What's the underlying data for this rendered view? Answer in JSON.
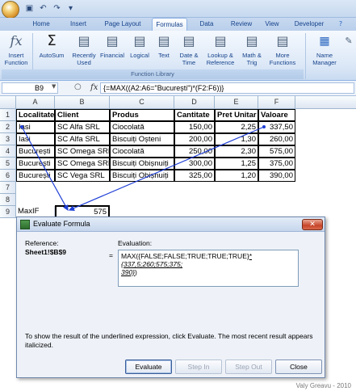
{
  "ribbon": {
    "tabs": [
      "Home",
      "Insert",
      "Page Layout",
      "Formulas",
      "Data",
      "Review",
      "View",
      "Developer"
    ],
    "active_tab": "Formulas",
    "buttons": [
      {
        "label": "Insert Function",
        "icon": "fx-icon"
      },
      {
        "label": "AutoSum",
        "icon": "sigma-icon"
      },
      {
        "label": "Recently Used",
        "icon": "book-icon"
      },
      {
        "label": "Financial",
        "icon": "book-icon"
      },
      {
        "label": "Logical",
        "icon": "book-icon"
      },
      {
        "label": "Text",
        "icon": "book-icon"
      },
      {
        "label": "Date & Time",
        "icon": "book-icon"
      },
      {
        "label": "Lookup & Reference",
        "icon": "book-icon"
      },
      {
        "label": "Math & Trig",
        "icon": "book-icon"
      },
      {
        "label": "More Functions",
        "icon": "book-icon"
      },
      {
        "label": "Name Manager",
        "icon": "name-manager-icon"
      }
    ],
    "group_label": "Function Library"
  },
  "formula_bar": {
    "name_box": "B9",
    "fx": "fx",
    "formula": "{=MAX((A2:A6=\"București\")*(F2:F6))}"
  },
  "columns": [
    "A",
    "B",
    "C",
    "D",
    "E",
    "F"
  ],
  "rows": [
    "1",
    "2",
    "3",
    "4",
    "5",
    "6",
    "7",
    "8",
    "9"
  ],
  "table": {
    "headers": [
      "Localitate",
      "Client",
      "Produs",
      "Cantitate",
      "Pret Unitar",
      "Valoare"
    ],
    "rows": [
      [
        "Iasi",
        "SC Alfa SRL",
        "Ciocolată",
        "150,00",
        "2,25",
        "337,50"
      ],
      [
        "Iasi",
        "SC Alfa SRL",
        "Biscuiți Oșteni",
        "200,00",
        "1,30",
        "260,00"
      ],
      [
        "București",
        "SC Omega SRL",
        "Ciocolată",
        "250,00",
        "2,30",
        "575,00"
      ],
      [
        "București",
        "SC Omega SRL",
        "Biscuiți Obișnuiți",
        "300,00",
        "1,25",
        "375,00"
      ],
      [
        "București",
        "SC Vega SRL",
        "Biscuiți Obișnuiți",
        "325,00",
        "1,20",
        "390,00"
      ]
    ]
  },
  "maxif": {
    "label": "MaxIF",
    "value": "575"
  },
  "dialog": {
    "title": "Evaluate Formula",
    "reference_label": "Reference:",
    "reference_value": "Sheet1!$B$9",
    "evaluation_label": "Evaluation:",
    "equals": "=",
    "evaluation_line1": "MAX({FALSE;FALSE;TRUE;TRUE;TRUE}",
    "evaluation_mult": "*",
    "evaluation_italic": "{337,5;260;575;375;",
    "evaluation_line2": "390}",
    "evaluation_close": ")",
    "hint": "To show the result of the underlined expression, click Evaluate.  The most recent result appears italicized.",
    "buttons": [
      "Evaluate",
      "Step In",
      "Step Out",
      "Close"
    ]
  },
  "watermark": "Valy Greavu - 2010"
}
